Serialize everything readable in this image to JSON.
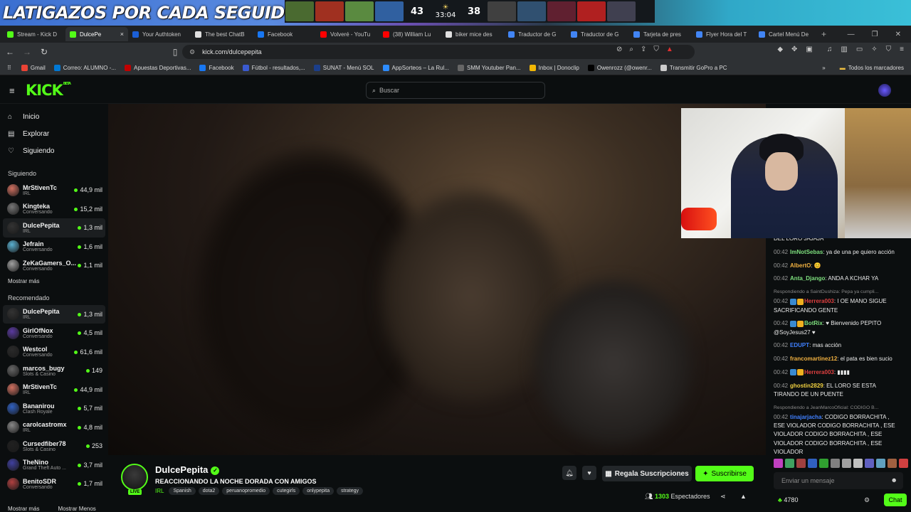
{
  "overlay": {
    "title": "LATIGAZOS POR CADA SEGUIDOR",
    "score_left": "43",
    "clock": "33:04",
    "score_right": "38"
  },
  "tabs": [
    {
      "label": "Stream - Kick D",
      "color": "#53fc18"
    },
    {
      "label": "DulcePe",
      "color": "#53fc18",
      "active": true,
      "close": "×"
    },
    {
      "label": "Your Authtoken",
      "color": "#1b5fd6"
    },
    {
      "label": "The best ChatB",
      "color": "#e0e0e0"
    },
    {
      "label": "Facebook",
      "color": "#1877f2"
    },
    {
      "label": "Volveré - YouTu",
      "color": "#ff0000"
    },
    {
      "label": "(38) William Lu",
      "color": "#ff0000"
    },
    {
      "label": "biker mice des",
      "color": "#e0e0e0"
    },
    {
      "label": "Traductor de G",
      "color": "#4285f4"
    },
    {
      "label": "Traductor de G",
      "color": "#4285f4"
    },
    {
      "label": "Tarjeta de pres",
      "color": "#4285f4"
    },
    {
      "label": "Flyer Hora del T",
      "color": "#4285f4"
    },
    {
      "label": "Cartel Menú De",
      "color": "#4285f4"
    }
  ],
  "tab_new": "+",
  "address": {
    "url": "kick.com/dulcepepita"
  },
  "bookmarks": [
    {
      "label": "Gmail",
      "color": "#ea4335"
    },
    {
      "label": "Correo: ALUMNO -...",
      "color": "#0078d4"
    },
    {
      "label": "Apuestas Deportivas...",
      "color": "#c00000"
    },
    {
      "label": "Facebook",
      "color": "#1877f2"
    },
    {
      "label": "Fútbol - resultados,...",
      "color": "#3a5ad0"
    },
    {
      "label": "SUNAT - Menú SOL",
      "color": "#1b3e8a"
    },
    {
      "label": "AppSorteos – La Rul...",
      "color": "#2d8cff"
    },
    {
      "label": "SMM Youtuber Pan...",
      "color": "#666666"
    },
    {
      "label": "Inbox | Donoclip",
      "color": "#f2b705"
    },
    {
      "label": "Owenrozz (@owenr...",
      "color": "#000000"
    },
    {
      "label": "Transmitir GoPro a PC",
      "color": "#cccccc"
    }
  ],
  "bookmarks_all": "Todos los marcadores",
  "kick": {
    "logo": "KICK",
    "logo_sup": "BETA",
    "search_placeholder": "Buscar"
  },
  "sidebar": {
    "nav": [
      {
        "label": "Inicio",
        "icon": "home-icon",
        "glyph": "⌂"
      },
      {
        "label": "Explorar",
        "icon": "compass-icon",
        "glyph": "▤"
      },
      {
        "label": "Siguiendo",
        "icon": "heart-icon",
        "glyph": "♡"
      }
    ],
    "following_title": "Siguiendo",
    "following": [
      {
        "name": "MrStivenTc",
        "cat": "IRL",
        "viewers": "44,9 mil",
        "color": "#d07060"
      },
      {
        "name": "Kingteka",
        "cat": "Conversando",
        "viewers": "15,2 mil",
        "color": "#777777"
      },
      {
        "name": "DulcePepita",
        "cat": "IRL",
        "viewers": "1,3 mil",
        "color": "#333333",
        "sel": true
      },
      {
        "name": "Jefrain",
        "cat": "Conversando",
        "viewers": "1,6 mil",
        "color": "#5ab0d0"
      },
      {
        "name": "ZeKaGamers_O...",
        "cat": "Conversando",
        "viewers": "1,1 mil",
        "color": "#a0a0a0"
      }
    ],
    "show_more": "Mostrar más",
    "recommended_title": "Recomendado",
    "recommended": [
      {
        "name": "DulcePepita",
        "cat": "IRL",
        "viewers": "1,3 mil",
        "color": "#333333",
        "sel": true
      },
      {
        "name": "GirlOfNox",
        "cat": "Conversando",
        "viewers": "4,5 mil",
        "color": "#5a3aa0"
      },
      {
        "name": "Westcol",
        "cat": "Conversando",
        "viewers": "61,6 mil",
        "color": "#2a2a2a"
      },
      {
        "name": "marcos_bugy",
        "cat": "Slots & Casino",
        "viewers": "149",
        "color": "#666666"
      },
      {
        "name": "MrStivenTc",
        "cat": "IRL",
        "viewers": "44,9 mil",
        "color": "#d07060"
      },
      {
        "name": "Bananirou",
        "cat": "Clash Royale",
        "viewers": "5,7 mil",
        "color": "#3060c0"
      },
      {
        "name": "carolcastromx",
        "cat": "IRL",
        "viewers": "4,8 mil",
        "color": "#888888"
      },
      {
        "name": "Cursedfiber78",
        "cat": "Slots & Casino",
        "viewers": "253",
        "color": "#202020"
      },
      {
        "name": "TheNino",
        "cat": "Grand Theft Auto ...",
        "viewers": "3,7 mil",
        "color": "#4040a0"
      },
      {
        "name": "BenitoSDR",
        "cat": "Conversando",
        "viewers": "1,7 mil",
        "color": "#b04040"
      }
    ],
    "footer_more": "Mostrar más",
    "footer_less": "Mostrar Menos"
  },
  "stream": {
    "name": "DulcePepita",
    "title": "REACCIONANDO LA NOCHE DORADA CON AMIGOS",
    "category": "IRL",
    "tags": [
      "Spanish",
      "dota2",
      "peruanopromedio",
      "cutegirls",
      "onlypepita",
      "strategy"
    ],
    "live": "LIVE",
    "gift_label": "Regala Suscripciones",
    "subscribe_label": "Suscribirse",
    "viewers": "1303",
    "viewers_label": "Espectadores"
  },
  "chat": {
    "messages": [
      {
        "time": "",
        "user": "",
        "color": "#eaeaea",
        "text": "DEL LORO JAJAJA"
      },
      {
        "time": "00:42",
        "user": "ImNotSebas",
        "color": "#7ee07e",
        "text": "ya de una pe quiero acción"
      },
      {
        "time": "00:42",
        "user": "AlbertO",
        "color": "#f0b040",
        "text": "😊"
      },
      {
        "time": "00:42",
        "user": "Anta_Django",
        "color": "#7ee07e",
        "text": "ANDA A KCHAR YA"
      },
      {
        "reply": "Respondiendo a SaintDushiza: Pepa ya cumpli...",
        "time": "00:42",
        "user": "Herrera003",
        "color": "#e04040",
        "badges": true,
        "text": "I OE MANO SIGUE SACRIFICANDO GENTE"
      },
      {
        "time": "00:42",
        "user": "BotRix",
        "color": "#7ee07e",
        "badges": true,
        "text": "♥ Bienvenido PEPITO @SoyJesus27 ♥"
      },
      {
        "time": "00:42",
        "user": "EDUPT",
        "color": "#4080ff",
        "text": "mas acción"
      },
      {
        "time": "00:42",
        "user": "francomartinez12",
        "color": "#f0b040",
        "text": "el pata es bien sucio"
      },
      {
        "time": "00:42",
        "user": "Herrera003",
        "color": "#e04040",
        "badges": true,
        "text": "▮▮▮▮"
      },
      {
        "time": "00:42",
        "user": "ghostin2829",
        "color": "#f0d040",
        "text": "EL LORO SE ESTA TIRANDO DE UN PUENTE"
      },
      {
        "reply": "Respondiendo a JeanMarcoOficial: CODIGO B...",
        "time": "00:42",
        "user": "tinajarjacha",
        "color": "#4080ff",
        "text": "CODIGO BORRACHITA , ESE VIOLADOR CODIGO BORRACHITA , ESE VIOLADOR CODIGO BORRACHITA , ESE VIOLADOR CODIGO BORRACHITA , ESE VIOLADOR"
      }
    ],
    "input_placeholder": "Enviar un mensaje",
    "points": "4780",
    "send_label": "Chat"
  },
  "colors": {
    "accent": "#53fc18",
    "bg": "#0b0e0f"
  }
}
